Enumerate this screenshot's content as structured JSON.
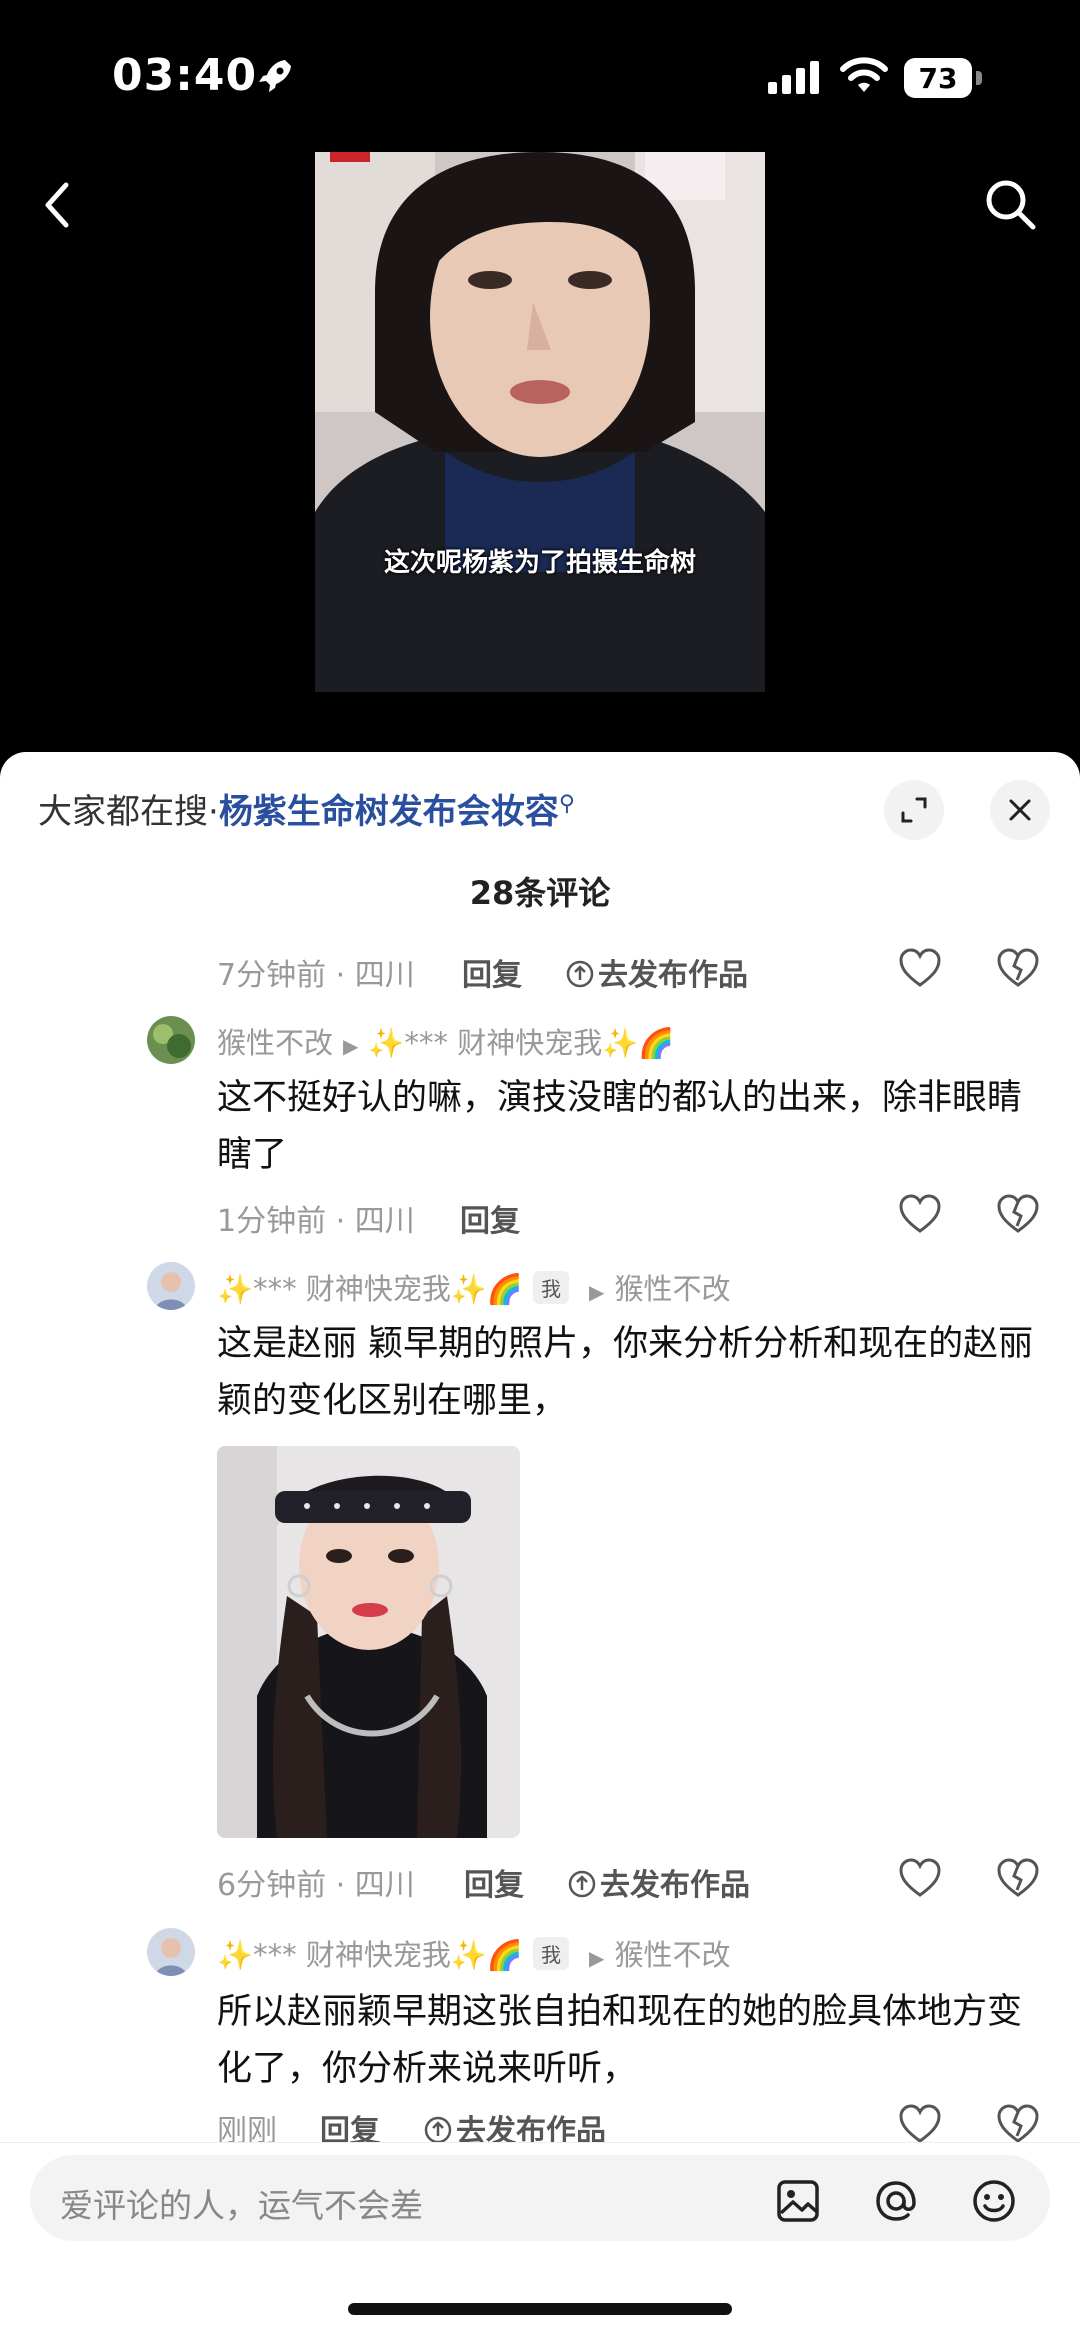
{
  "status_bar": {
    "time": "03:40",
    "battery": "73"
  },
  "video": {
    "subtitle": "这次呢杨紫为了拍摄生命树"
  },
  "search_suggest": {
    "prefix": "大家都在搜·",
    "query": "杨紫生命树发布会妆容"
  },
  "comment_count": "28条评论",
  "comments": [
    {
      "meta_time": "7分钟前 · 四川",
      "reply": "回复",
      "publish": "去发布作品"
    },
    {
      "user": "猴性不改",
      "reply_to": "✨*** 财神快宠我✨🌈",
      "text": "这不挺好认的嘛，演技没瞎的都认的出来，除非眼睛瞎了",
      "meta_time": "1分钟前 · 四川",
      "reply": "回复"
    },
    {
      "user": "✨*** 财神快宠我✨🌈",
      "badge": "我",
      "reply_to": "猴性不改",
      "text": "这是赵丽 颖早期的照片，你来分析分析和现在的赵丽颖的变化区别在哪里，",
      "meta_time": "6分钟前 · 四川",
      "reply": "回复",
      "publish": "去发布作品"
    },
    {
      "user": "✨*** 财神快宠我✨🌈",
      "badge": "我",
      "reply_to": "猴性不改",
      "text": "所以赵丽颖早期这张自拍和现在的她的脸具体地方变化了，你分析来说来听听，",
      "meta_time": "刚刚",
      "reply": "回复",
      "publish": "去发布作品"
    }
  ],
  "input": {
    "placeholder": "爱评论的人，运气不会差"
  },
  "icons": {
    "status": [
      "rocket-icon",
      "signal-icon",
      "wifi-icon"
    ],
    "header": [
      "back-icon",
      "search-icon"
    ],
    "sheet": [
      "expand-icon",
      "close-icon"
    ],
    "comment": [
      "publish-icon",
      "like-icon",
      "dislike-icon"
    ],
    "input": [
      "image-icon",
      "mention-icon",
      "emoji-icon"
    ]
  },
  "colors": {
    "link": "#2a4f9e",
    "muted": "#999999",
    "background": "#000000",
    "sheet": "#ffffff"
  }
}
